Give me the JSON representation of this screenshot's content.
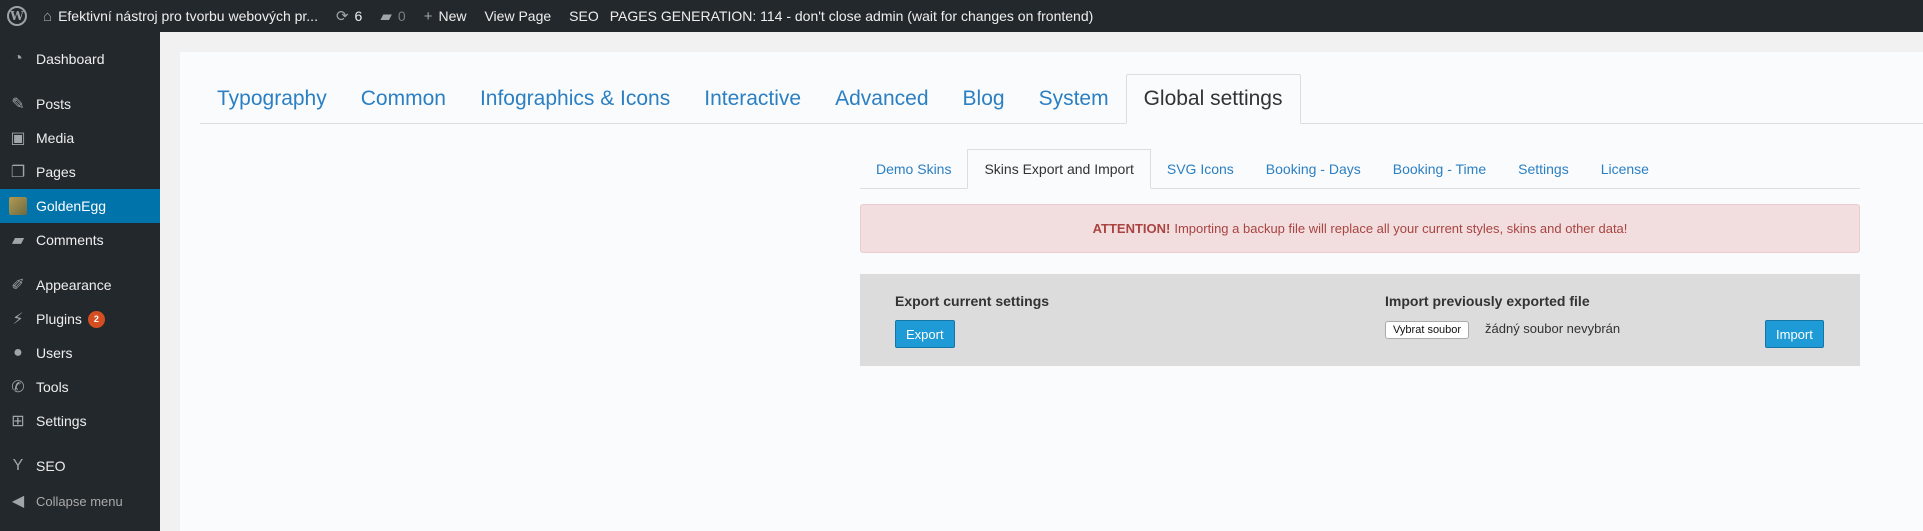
{
  "adminbar": {
    "site_title": "Efektivní nástroj pro tvorbu webových pr...",
    "updates_count": "6",
    "comments_count": "0",
    "new_label": "New",
    "view_page_label": "View Page",
    "seo_label": "SEO",
    "notice": "PAGES GENERATION: 114 - don't close admin (wait for changes on frontend)"
  },
  "sidebar": {
    "items": [
      {
        "label": "Dashboard",
        "icon": "dashboard-icon"
      },
      {
        "label": "Posts",
        "icon": "pin-icon"
      },
      {
        "label": "Media",
        "icon": "media-icon"
      },
      {
        "label": "Pages",
        "icon": "pages-icon"
      },
      {
        "label": "GoldenEgg",
        "icon": "goldenegg-icon"
      },
      {
        "label": "Comments",
        "icon": "comment-icon"
      },
      {
        "label": "Appearance",
        "icon": "brush-icon"
      },
      {
        "label": "Plugins",
        "icon": "plugin-icon",
        "badge": "2"
      },
      {
        "label": "Users",
        "icon": "user-icon"
      },
      {
        "label": "Tools",
        "icon": "wrench-icon"
      },
      {
        "label": "Settings",
        "icon": "settings-icon"
      },
      {
        "label": "SEO",
        "icon": "yoast-icon"
      },
      {
        "label": "Collapse menu",
        "icon": "collapse-icon"
      }
    ],
    "current": "GoldenEgg"
  },
  "main_tabs": [
    {
      "label": "Typography"
    },
    {
      "label": "Common"
    },
    {
      "label": "Infographics & Icons"
    },
    {
      "label": "Interactive"
    },
    {
      "label": "Advanced"
    },
    {
      "label": "Blog"
    },
    {
      "label": "System"
    },
    {
      "label": "Global settings",
      "active": true
    }
  ],
  "sub_tabs": [
    {
      "label": "Demo Skins"
    },
    {
      "label": "Skins Export and Import",
      "active": true
    },
    {
      "label": "SVG Icons"
    },
    {
      "label": "Booking - Days"
    },
    {
      "label": "Booking - Time"
    },
    {
      "label": "Settings"
    },
    {
      "label": "License"
    }
  ],
  "alert": {
    "strong": "ATTENTION!",
    "text": "Importing a backup file will replace all your current styles, skins and other data!"
  },
  "export": {
    "title": "Export current settings",
    "button": "Export"
  },
  "import": {
    "title": "Import previously exported file",
    "file_button": "Vybrat soubor",
    "file_status": "žádný soubor nevybrán",
    "button": "Import"
  },
  "colors": {
    "accent": "#0073aa",
    "link": "#2b7fc3",
    "alert_text": "#a94442",
    "alert_bg": "#f2dede",
    "button": "#1e9bd6"
  }
}
